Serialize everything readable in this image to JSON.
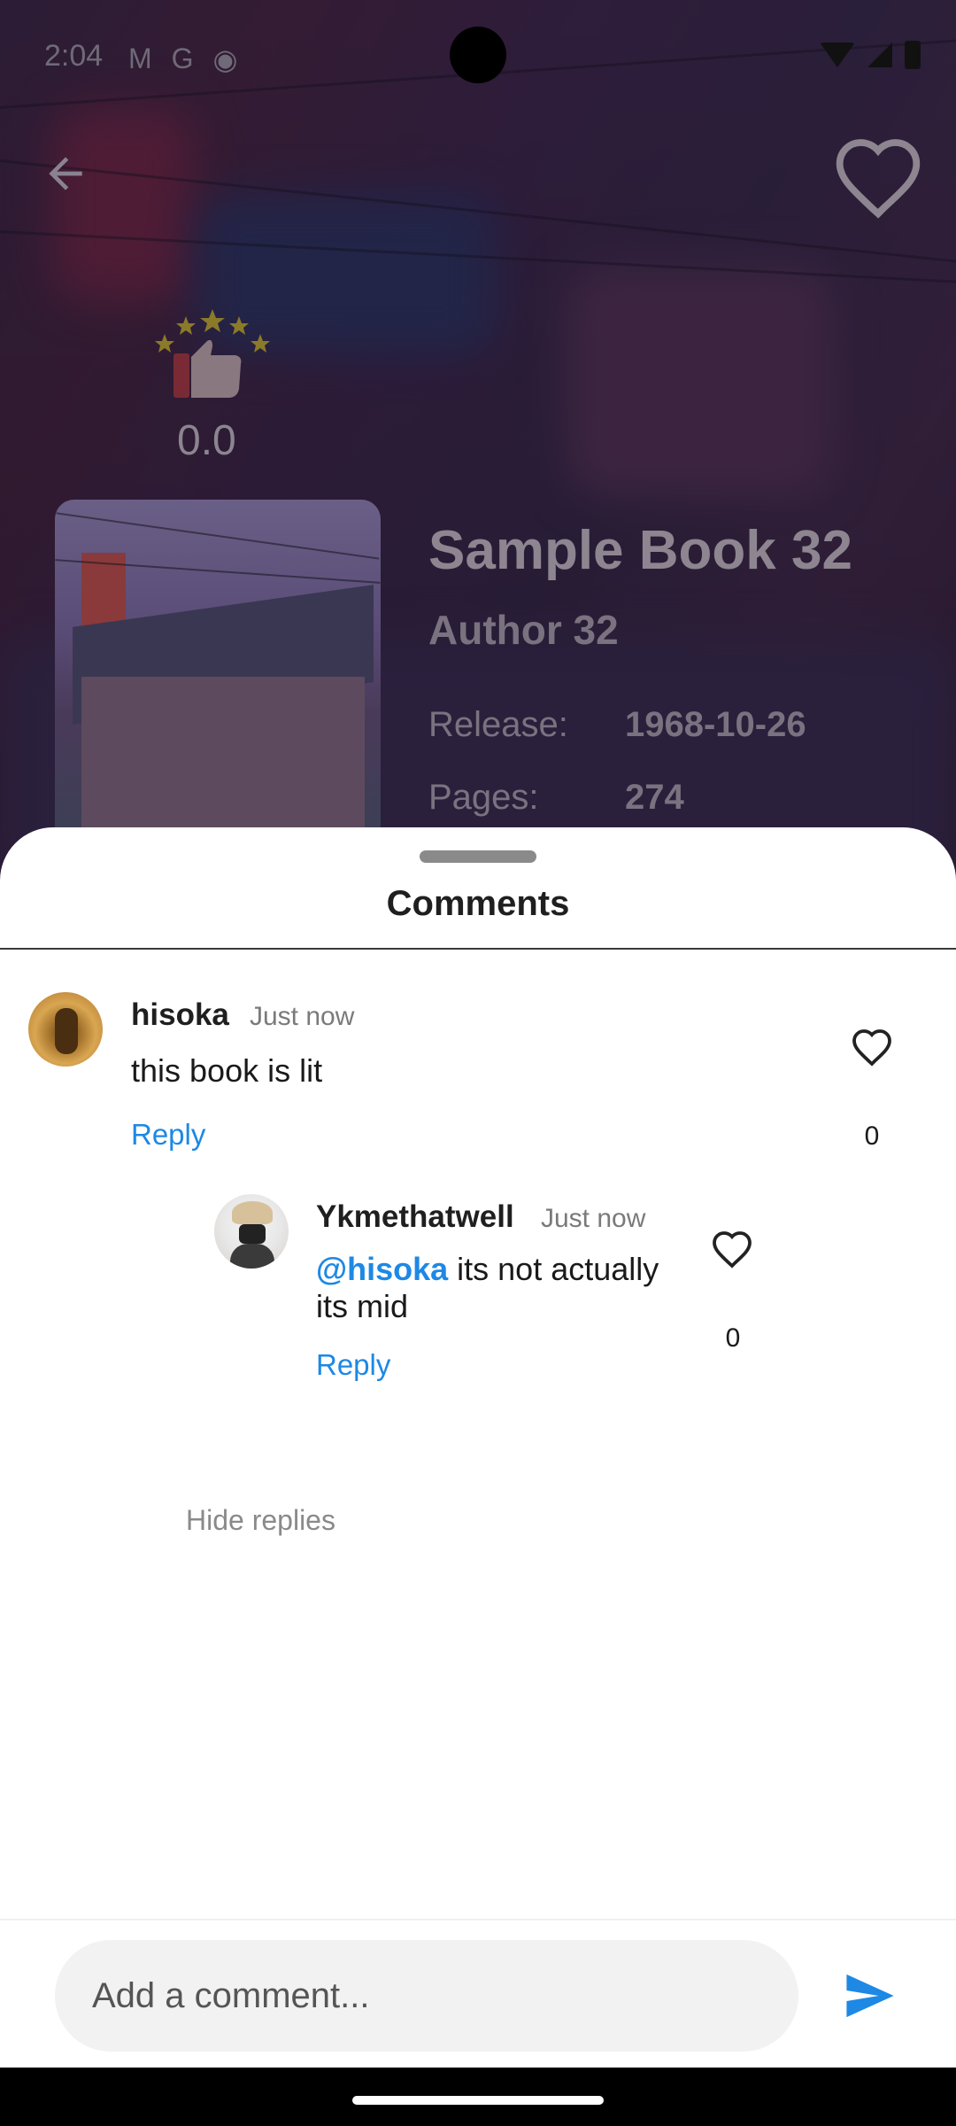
{
  "status_bar": {
    "time": "2:04",
    "left_icons": [
      "gmail-icon",
      "google-icon",
      "app-icon"
    ]
  },
  "book": {
    "rating": "0.0",
    "title": "Sample Book 32",
    "author": "Author 32",
    "release_label": "Release:",
    "release_value": "1968-10-26",
    "pages_label": "Pages:",
    "pages_value": "274"
  },
  "sheet": {
    "title": "Comments",
    "hide_replies": "Hide replies"
  },
  "comments": [
    {
      "user": "hisoka",
      "time": "Just now",
      "text": "this book is lit",
      "reply_label": "Reply",
      "likes": "0"
    }
  ],
  "replies": [
    {
      "user": "Ykmethatwell",
      "time": "Just now",
      "mention": "@hisoka",
      "text": " its not actually its mid",
      "reply_label": "Reply",
      "likes": "0"
    }
  ],
  "input": {
    "placeholder": "Add a comment..."
  },
  "colors": {
    "accent": "#1e88e5",
    "sheet_bg": "#ffffff",
    "input_bg": "#f2f2f2"
  }
}
